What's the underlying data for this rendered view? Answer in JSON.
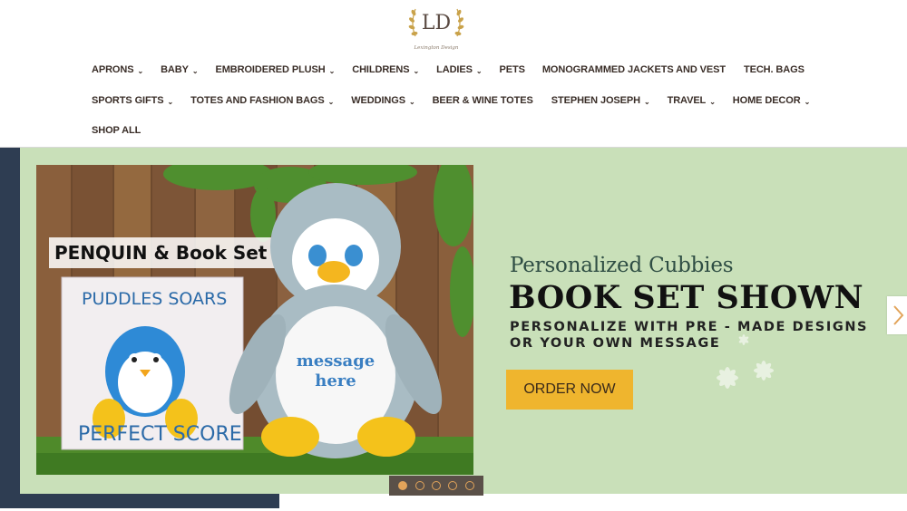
{
  "logo": {
    "initials": "LD",
    "caption": "Lexington Design"
  },
  "nav": {
    "row1": [
      {
        "label": "APRONS",
        "dropdown": true
      },
      {
        "label": "BABY",
        "dropdown": true
      },
      {
        "label": "EMBROIDERED PLUSH",
        "dropdown": true
      },
      {
        "label": "CHILDRENS",
        "dropdown": true
      },
      {
        "label": "LADIES",
        "dropdown": true
      },
      {
        "label": "PETS",
        "dropdown": false
      },
      {
        "label": "MONOGRAMMED JACKETS AND VEST",
        "dropdown": false
      },
      {
        "label": "TECH. BAGS",
        "dropdown": false
      }
    ],
    "row2": [
      {
        "label": "SPORTS GIFTS",
        "dropdown": true
      },
      {
        "label": "TOTES AND FASHION BAGS",
        "dropdown": true
      },
      {
        "label": "WEDDINGS",
        "dropdown": true
      },
      {
        "label": "BEER & WINE TOTES",
        "dropdown": false
      },
      {
        "label": "STEPHEN JOSEPH",
        "dropdown": true
      },
      {
        "label": "TRAVEL",
        "dropdown": true
      },
      {
        "label": "HOME DECOR",
        "dropdown": true
      }
    ],
    "row3": [
      {
        "label": "SHOP ALL",
        "dropdown": false
      }
    ]
  },
  "hero": {
    "image": {
      "headline": "PENQUIN & Book Set",
      "book_title": "PUDDLES SOARS",
      "book_subtitle": "PERFECT SCORE",
      "plush_text_1": "message",
      "plush_text_2": "here"
    },
    "subtitle": "Personalized Cubbies",
    "title": "BOOK SET SHOWN",
    "desc_line1": "PERSONALIZE WITH PRE - MADE DESIGNS",
    "desc_line2": "OR YOUR OWN MESSAGE",
    "cta": "ORDER NOW",
    "slides": {
      "count": 5,
      "active": 1
    }
  },
  "icons": {
    "chevron": "chevron-down-icon",
    "next": "chevron-right-icon"
  },
  "colors": {
    "hero_bg": "#c9e0b9",
    "navy": "#2e3d52",
    "cta": "#efb52e",
    "dot": "#e2a45a"
  }
}
